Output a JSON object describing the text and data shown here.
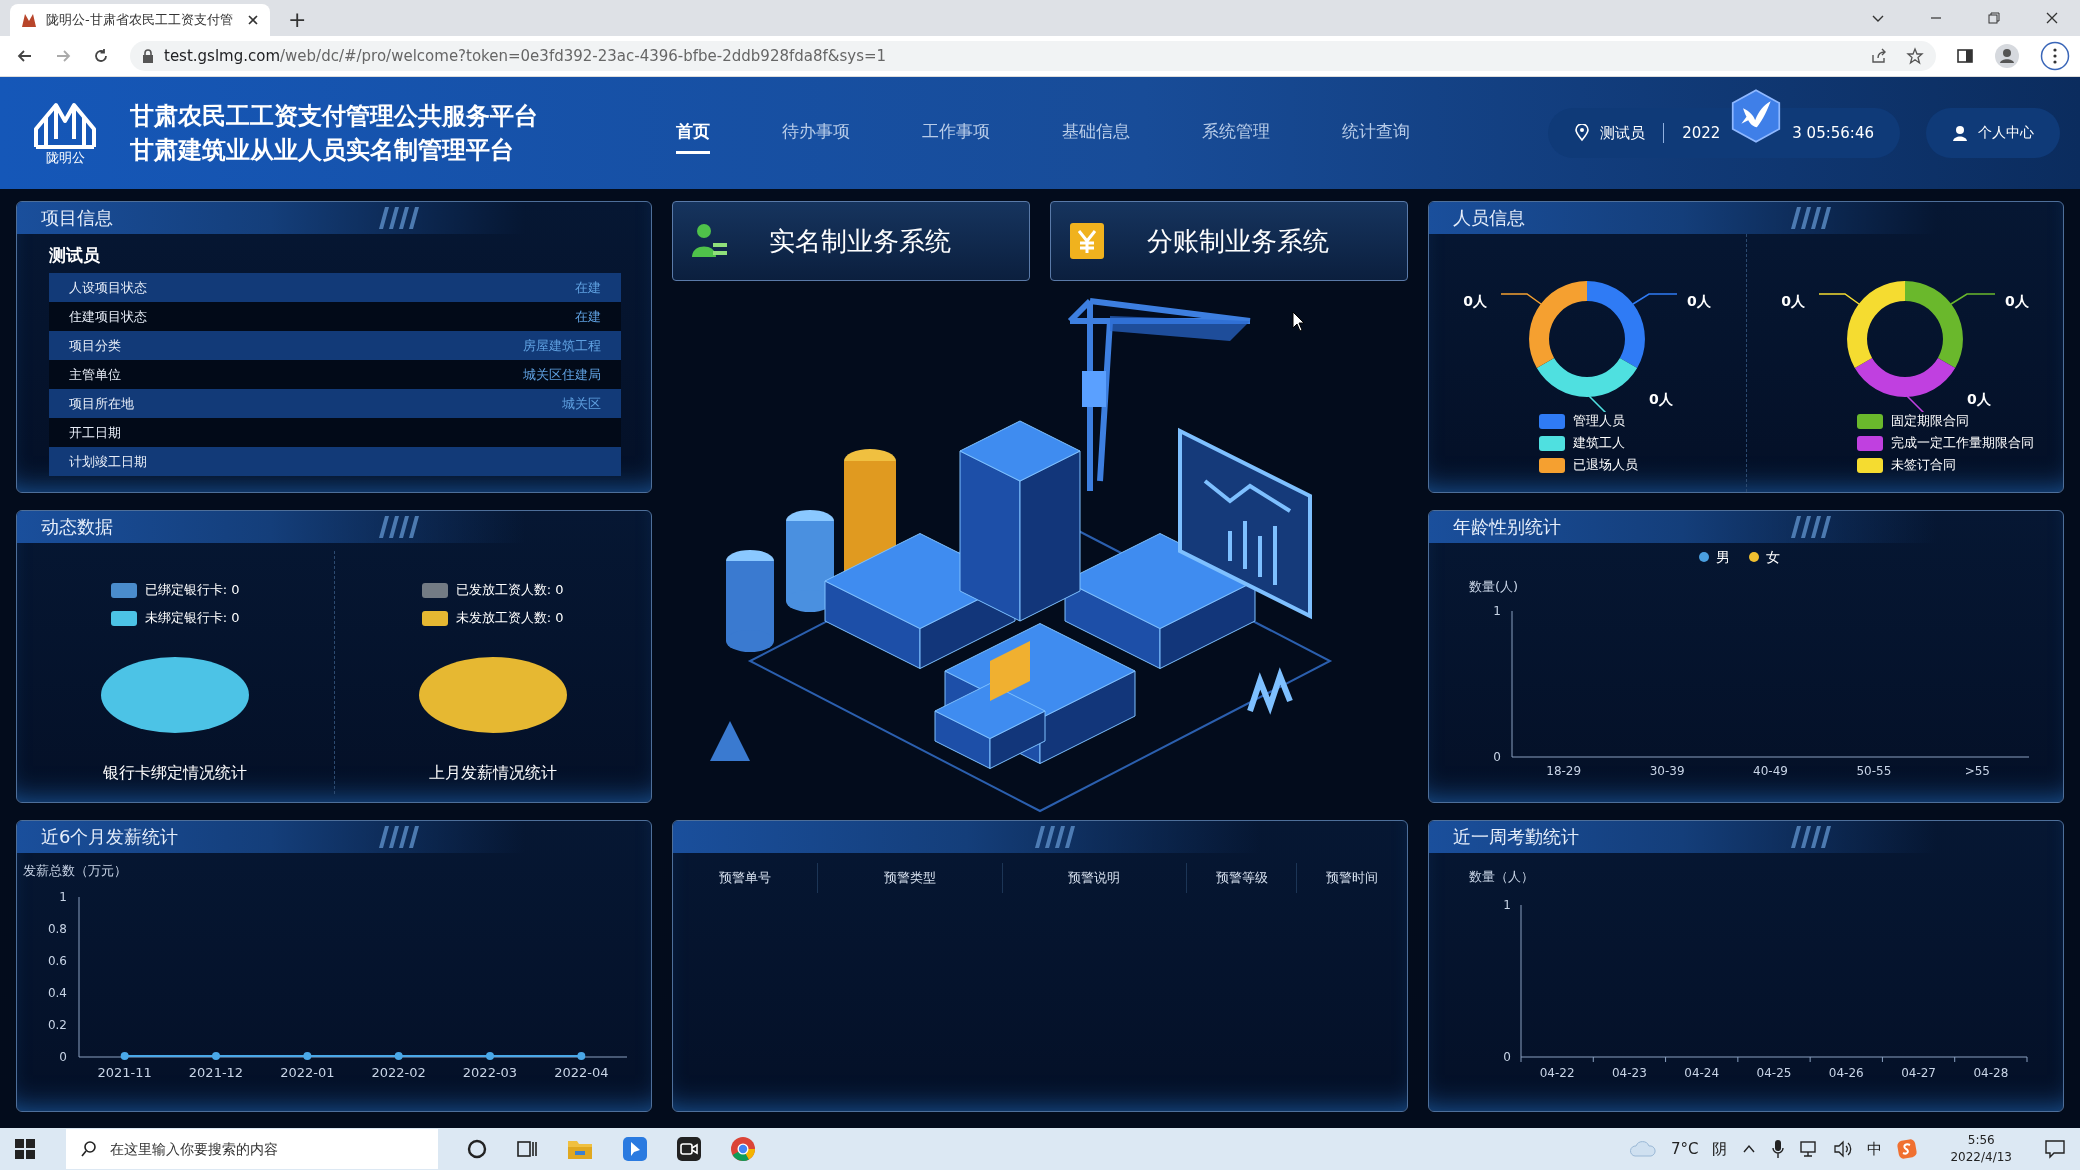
{
  "browser": {
    "tab_title": "陇明公-甘肃省农民工工资支付管",
    "new_tab": "+",
    "url_host": "test.gslmg.com",
    "url_path": "/web/dc/#/pro/welcome?token=0e3fd392-23ac-4396-bfbe-2ddb928fda8f&sys=1"
  },
  "header": {
    "logo_text": "陇明公",
    "titles": [
      "甘肃农民工工资支付管理公共服务平台",
      "甘肃建筑业从业人员实名制管理平台"
    ],
    "nav": [
      {
        "label": "首页",
        "selected": true
      },
      {
        "label": "待办事项",
        "selected": false
      },
      {
        "label": "工作事项",
        "selected": false
      },
      {
        "label": "基础信息",
        "selected": false
      },
      {
        "label": "系统管理",
        "selected": false
      },
      {
        "label": "统计查询",
        "selected": false
      }
    ],
    "user": "测试员",
    "datetime_parts": [
      "2022",
      "3 05:56:46"
    ],
    "profile": "个人中心"
  },
  "project_info": {
    "title": "项目信息",
    "name": "测试员",
    "rows": [
      {
        "label": "人设项目状态",
        "value": "在建"
      },
      {
        "label": "住建项目状态",
        "value": "在建"
      },
      {
        "label": "项目分类",
        "value": "房屋建筑工程"
      },
      {
        "label": "主管单位",
        "value": "城关区住建局"
      },
      {
        "label": "项目所在地",
        "value": "城关区"
      },
      {
        "label": "开工日期"
      },
      {
        "label": "计划竣工日期"
      }
    ]
  },
  "dynamic": {
    "title": "动态数据",
    "charts": [
      {
        "caption": "银行卡绑定情况统计",
        "legend": [
          {
            "label": "已绑定银行卡: 0",
            "color": "#4a8ccc"
          },
          {
            "label": "未绑定银行卡: 0",
            "color": "#4cc3e6"
          }
        ]
      },
      {
        "caption": "上月发薪情况统计",
        "legend": [
          {
            "label": "已发放工资人数: 0",
            "color": "#737b84"
          },
          {
            "label": "未发放工资人数: 0",
            "color": "#e6b832"
          }
        ]
      }
    ]
  },
  "systems": [
    {
      "label": "实名制业务系统",
      "kind": "person"
    },
    {
      "label": "分账制业务系统",
      "kind": "yen"
    }
  ],
  "salary": {
    "title": "近6个月发薪统计",
    "chart_data": {
      "type": "line",
      "ylabel": "发薪总数（万元）",
      "categories": [
        "2021-11",
        "2021-12",
        "2022-01",
        "2022-02",
        "2022-03",
        "2022-04"
      ],
      "ylim": [
        0,
        1
      ],
      "yticks": [
        0,
        0.2,
        0.4,
        0.6,
        0.8,
        1
      ],
      "series": [
        {
          "color": "#4aa8e8",
          "marker": "circle",
          "values": [
            0,
            0,
            0,
            0,
            0,
            0
          ]
        }
      ]
    }
  },
  "warnings": {
    "columns": [
      "预警单号",
      "预警类型",
      "预警说明",
      "预警等级",
      "预警时间"
    ]
  },
  "personnel": {
    "title": "人员信息",
    "donuts": [
      {
        "segments": [
          {
            "label": "管理人员",
            "color": "#2f7bf5",
            "value_label": "0人"
          },
          {
            "label": "建筑工人",
            "color": "#4fe0e0",
            "value_label": "0人"
          },
          {
            "label": "已退场人员",
            "color": "#f5a030",
            "value_label": "0人"
          }
        ]
      },
      {
        "segments": [
          {
            "label": "固定期限合同",
            "color": "#6ab82c",
            "value_label": "0人"
          },
          {
            "label": "完成一定工作量期限合同",
            "color": "#c040e0",
            "value_label": "0人"
          },
          {
            "label": "未签订合同",
            "color": "#f5dc30",
            "value_label": "0人"
          }
        ]
      }
    ]
  },
  "age": {
    "title": "年龄性别统计",
    "chart_data": {
      "type": "bar",
      "ylabel": "数量(人)",
      "categories": [
        "18-29",
        "30-39",
        "40-49",
        "50-55",
        ">55"
      ],
      "ylim": [
        0,
        1
      ],
      "yticks": [
        0,
        1
      ],
      "series": [
        {
          "name": "男",
          "color": "#4a9fe0",
          "values": [
            0,
            0,
            0,
            0,
            0
          ]
        },
        {
          "name": "女",
          "color": "#f0c030",
          "values": [
            0,
            0,
            0,
            0,
            0
          ]
        }
      ]
    }
  },
  "attendance": {
    "title": "近一周考勤统计",
    "chart_data": {
      "type": "bar",
      "ylabel": "数量（人）",
      "categories": [
        "04-22",
        "04-23",
        "04-24",
        "04-25",
        "04-26",
        "04-27",
        "04-28"
      ],
      "ylim": [
        0,
        1
      ],
      "yticks": [
        0,
        1
      ]
    }
  },
  "taskbar": {
    "search_placeholder": "在这里输入你要搜索的内容",
    "temperature": "7°C",
    "weather": "阴",
    "ime": "中",
    "time": "5:56",
    "date": "2022/4/13"
  }
}
